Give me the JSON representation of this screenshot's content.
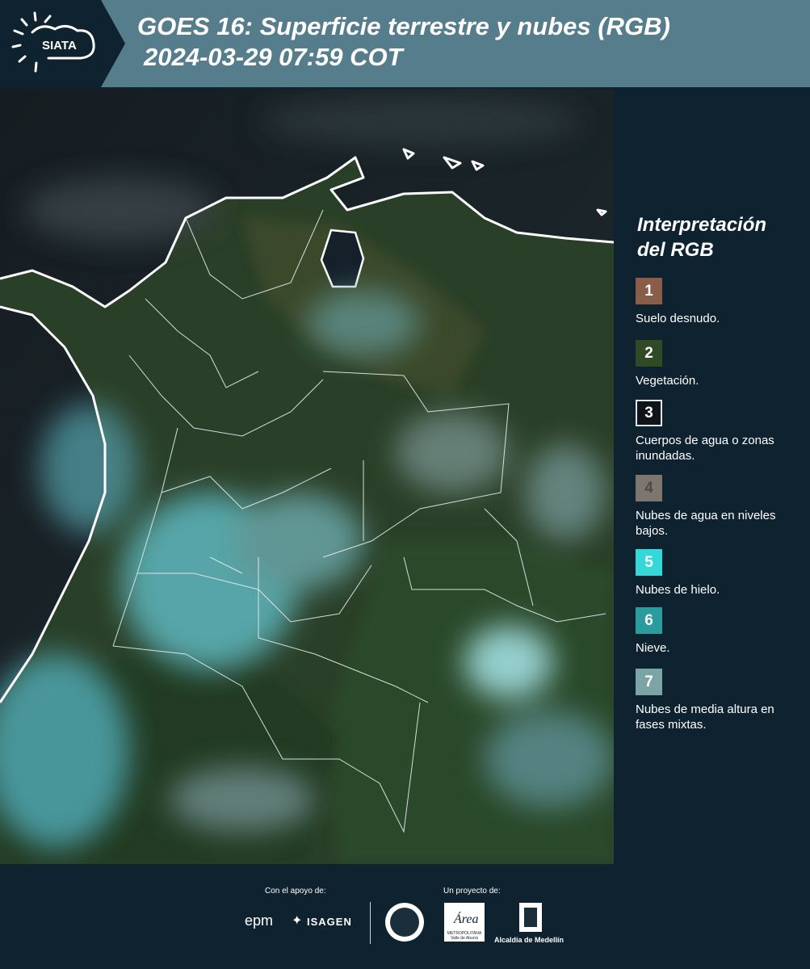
{
  "header": {
    "logo_text": "SIATA",
    "title_line1": "GOES 16: Superficie terrestre y nubes (RGB)",
    "title_line2": "2024-03-29 07:59 COT"
  },
  "legend": {
    "title_line1": "Interpretación",
    "title_line2": "del RGB",
    "items": [
      {
        "number": "1",
        "label": "Suelo desnudo.",
        "color": "#8a5d49"
      },
      {
        "number": "2",
        "label": "Vegetación.",
        "color": "#2f4a25"
      },
      {
        "number": "3",
        "label": "Cuerpos de agua o zonas inundadas.",
        "color": "#111417"
      },
      {
        "number": "4",
        "label": "Nubes de agua en niveles bajos.",
        "color": "#7d766e"
      },
      {
        "number": "5",
        "label": "Nubes de hielo.",
        "color": "#35d8d8"
      },
      {
        "number": "6",
        "label": "Nieve.",
        "color": "#2a9c9e"
      },
      {
        "number": "7",
        "label": "Nubes de media altura en fases mixtas.",
        "color": "#7ba5a5"
      }
    ]
  },
  "footer": {
    "support_caption": "Con el apoyo de:",
    "project_caption": "Un proyecto de:",
    "sponsor_epm": "epm",
    "sponsor_isagen": "ISAGEN",
    "area_name": "Área",
    "area_sub": "METROPOLITANA Valle de Aburrá",
    "alcaldia": "Alcaldía de Medellín"
  },
  "colors": {
    "header_bg": "#557d8b",
    "logo_bg": "#0f2230",
    "page_bg": "#0f2230"
  }
}
